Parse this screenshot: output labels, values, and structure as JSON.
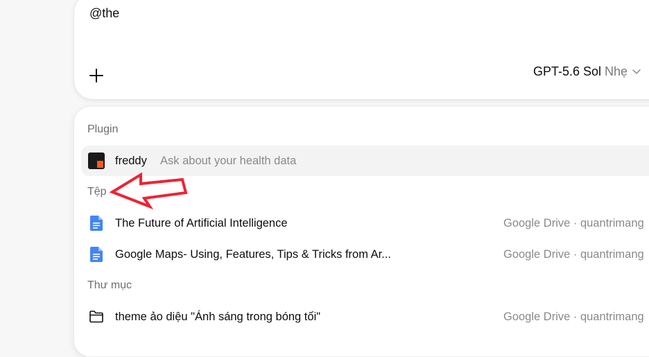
{
  "composer": {
    "input_value": "@the",
    "plus_icon": "plus-icon",
    "model_name": "GPT-5.6 Sol",
    "model_effort": "Nhẹ",
    "chevron_icon": "chevron-down-icon"
  },
  "mention_menu": {
    "plugin_title": "Plugin",
    "plugin_item": {
      "name": "freddy",
      "description": "Ask about your health data",
      "icon": "freddy-app-icon",
      "icon_colors": [
        "#1a1a1a",
        "#ff5a1f"
      ]
    },
    "files_title": "Tệp",
    "files": [
      {
        "name": "The Future of Artificial Intelligence",
        "source": "Google Drive · quantrimang",
        "icon": "google-doc-icon"
      },
      {
        "name": "Google Maps- Using, Features, Tips & Tricks from Ar...",
        "source": "Google Drive · quantrimang",
        "icon": "google-doc-icon"
      }
    ],
    "folders_title": "Thư mục",
    "folders": [
      {
        "name": "theme ảo diệu \"Ánh sáng trong bóng tối\"",
        "source": "Google Drive · quantrimang",
        "icon": "folder-icon"
      }
    ]
  },
  "annotation": {
    "icon": "red-arrow-icon",
    "color": "#ee2233"
  },
  "colors": {
    "doc_blue": "#4285f4",
    "highlight": "#f3f3f3"
  }
}
